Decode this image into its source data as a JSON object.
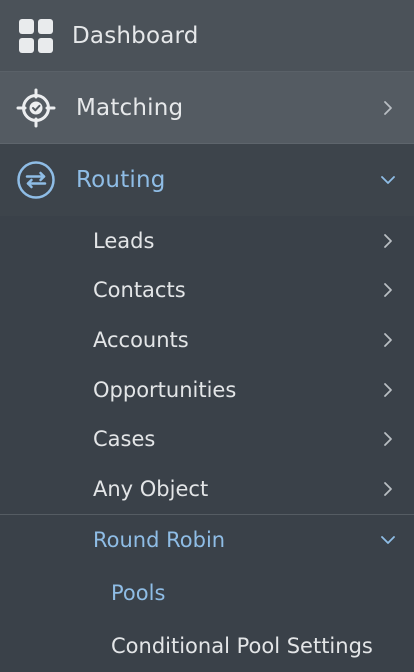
{
  "sidebar": {
    "dashboard": {
      "label": "Dashboard",
      "icon": "grid-icon"
    },
    "matching": {
      "label": "Matching",
      "icon": "target-check-icon"
    },
    "routing": {
      "label": "Routing",
      "icon": "swap-arrows-icon",
      "expanded": true
    },
    "routing_items": [
      {
        "label": "Leads"
      },
      {
        "label": "Contacts"
      },
      {
        "label": "Accounts"
      },
      {
        "label": "Opportunities"
      },
      {
        "label": "Cases"
      },
      {
        "label": "Any Object"
      }
    ],
    "round_robin": {
      "label": "Round Robin",
      "expanded": true
    },
    "round_robin_items": [
      {
        "label": "Pools",
        "active": true
      },
      {
        "label": "Conditional Pool Settings"
      }
    ]
  },
  "colors": {
    "background": "#3a4149",
    "active_text": "#8fbde6",
    "text": "#e6e8ea"
  }
}
